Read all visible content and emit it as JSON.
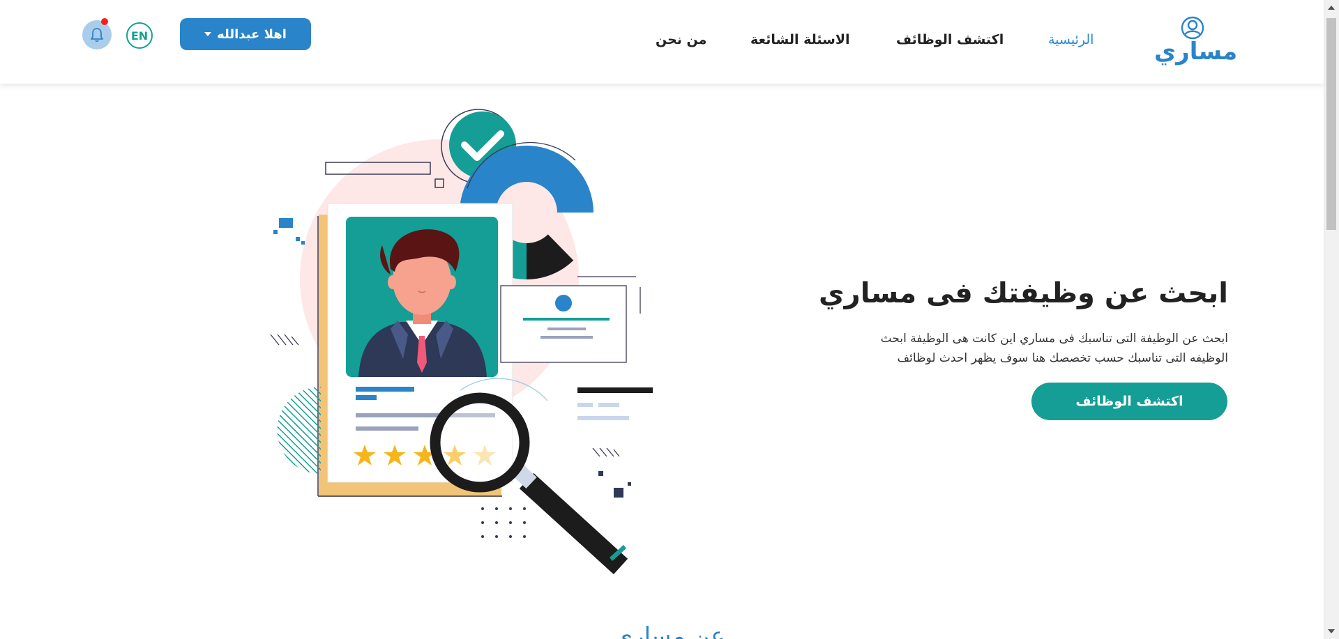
{
  "header": {
    "brand_name": "مساري",
    "nav": [
      {
        "label": "الرئيسية",
        "active": true
      },
      {
        "label": "اكتشف الوظائف",
        "active": false
      },
      {
        "label": "الاسئلة الشائعة",
        "active": false
      },
      {
        "label": "من نحن",
        "active": false
      }
    ],
    "user_button_label": "اهلا عبدالله",
    "language_label": "EN",
    "has_notification": true
  },
  "hero": {
    "title": "ابحث عن وظيفتك فى مساري",
    "description": "ابحث عن الوظيفة التى تناسبك فى مساري اين كانت هى الوظيفة ابحث الوظيفه التى تناسبك حسب تخصصك هنا سوف يظهر احدث لوظائف",
    "cta_label": "اكتشف الوظائف"
  },
  "illustration": {
    "rating": 4.5,
    "rating_max": 5
  },
  "about_section_title": "عن مساري",
  "colors": {
    "primary_blue": "#2a84c9",
    "primary_teal": "#149e95",
    "notification_dot": "#ff1a1a",
    "star": "#f7b51c"
  },
  "icons": [
    "user-badge-icon",
    "bell-icon",
    "caret-down-icon"
  ]
}
